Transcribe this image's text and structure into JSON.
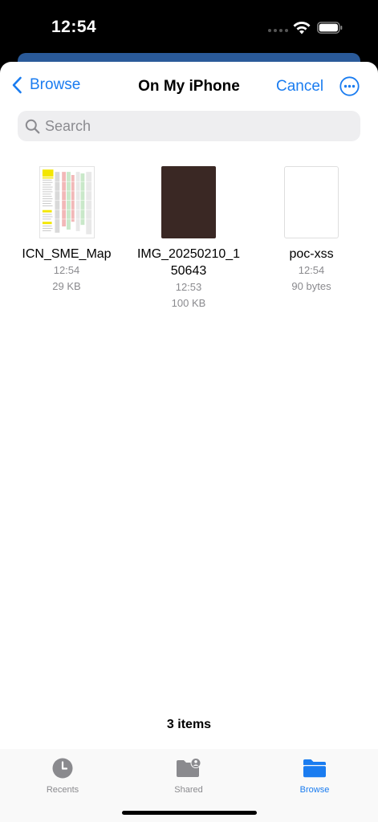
{
  "status_bar": {
    "time": "12:54"
  },
  "nav": {
    "back_label": "Browse",
    "title": "On My iPhone",
    "cancel_label": "Cancel"
  },
  "search": {
    "placeholder": "Search",
    "value": ""
  },
  "files": [
    {
      "name": "ICN_SME_Map",
      "time": "12:54",
      "size": "29 KB",
      "thumbnail": "spreadsheet"
    },
    {
      "name": "IMG_20250210_1\n50643",
      "time": "12:53",
      "size": "100 KB",
      "thumbnail": "photo"
    },
    {
      "name": "poc-xss",
      "time": "12:54",
      "size": "90 bytes",
      "thumbnail": "blank-document"
    }
  ],
  "footer": {
    "items_count": "3 items"
  },
  "tabs": [
    {
      "label": "Recents",
      "icon": "clock-icon",
      "active": false
    },
    {
      "label": "Shared",
      "icon": "shared-folder-icon",
      "active": false
    },
    {
      "label": "Browse",
      "icon": "folder-icon",
      "active": true
    }
  ],
  "colors": {
    "accent": "#1a7cf0",
    "inactive_tab": "#8a8a8e"
  }
}
